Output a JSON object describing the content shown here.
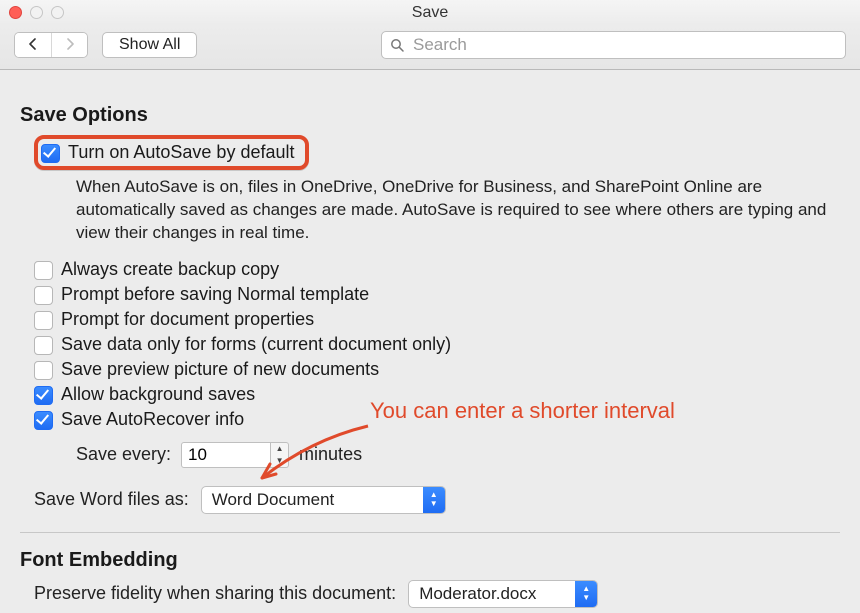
{
  "window": {
    "title": "Save"
  },
  "toolbar": {
    "show_all": "Show All",
    "search_placeholder": "Search"
  },
  "sections": {
    "save_options": {
      "title": "Save Options"
    },
    "font_embedding": {
      "title": "Font Embedding"
    }
  },
  "options": {
    "autosave": {
      "label": "Turn on AutoSave by default",
      "checked": true,
      "desc": "When AutoSave is on, files in OneDrive, OneDrive for Business, and SharePoint Online are automatically saved as changes are made. AutoSave is required to see where others are typing and view their changes in real time."
    },
    "backup_copy": {
      "label": "Always create backup copy",
      "checked": false
    },
    "prompt_normal": {
      "label": "Prompt before saving Normal template",
      "checked": false
    },
    "prompt_props": {
      "label": "Prompt for document properties",
      "checked": false
    },
    "forms_only": {
      "label": "Save data only for forms (current document only)",
      "checked": false
    },
    "preview_pic": {
      "label": "Save preview picture of new documents",
      "checked": false
    },
    "bg_saves": {
      "label": "Allow background saves",
      "checked": true
    },
    "autorecover": {
      "label": "Save AutoRecover info",
      "checked": true
    }
  },
  "save_every": {
    "label": "Save every:",
    "value": "10",
    "unit": "minutes"
  },
  "save_as": {
    "label": "Save Word files as:",
    "value": "Word Document"
  },
  "preserve_fidelity": {
    "label": "Preserve fidelity when sharing this document:",
    "value": "Moderator.docx"
  },
  "annotation": "You can enter a shorter interval"
}
